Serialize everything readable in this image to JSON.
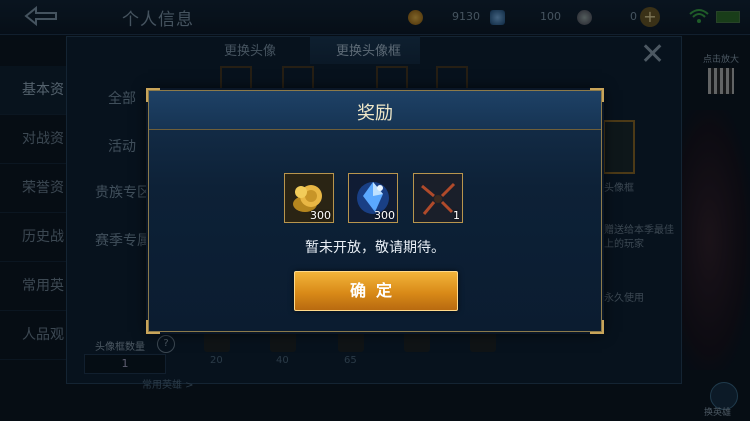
{
  "header": {
    "title": "个人信息",
    "gold": "9130",
    "diamonds": "100",
    "tokens": "0"
  },
  "leftnav": {
    "items": [
      "基本资",
      "对战资",
      "荣誉资",
      "历史战",
      "常用英",
      "人品观"
    ]
  },
  "tabs": [
    "更换头像",
    "更换头像框"
  ],
  "categories": [
    "全部",
    "活动",
    "贵族专区",
    "赛季专属"
  ],
  "right_panel": {
    "frame_label": "头像框",
    "desc_line1": "赠送给本季最佳",
    "desc_line2": "上的玩家",
    "duration": "永久使用",
    "qr_label": "点击放大",
    "hero_button": "换英雄"
  },
  "bottom": {
    "count_label": "头像框数量",
    "count_value": "1",
    "thumb_counts": [
      "20",
      "40",
      "65"
    ],
    "link": "常用英雄 >"
  },
  "dialog": {
    "title": "奖励",
    "items": [
      {
        "icon": "gold-coin-icon",
        "qty": "300"
      },
      {
        "icon": "blue-crystal-icon",
        "qty": "300"
      },
      {
        "icon": "avatar-frame-icon",
        "qty": "1"
      }
    ],
    "message": "暂未开放，敬请期待。",
    "confirm": "确定"
  },
  "colors": {
    "accent_gold": "#d98a18",
    "border_gold": "#b8954d"
  }
}
